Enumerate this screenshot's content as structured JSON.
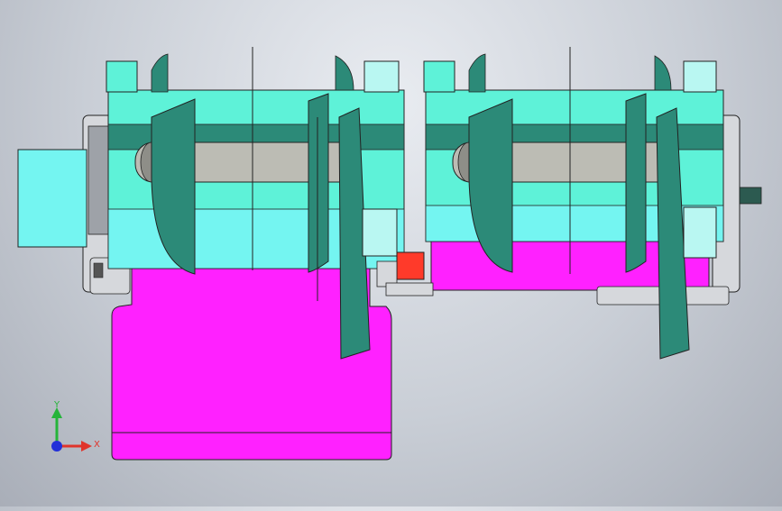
{
  "viewport": {
    "background_top": "#e9ecf1",
    "background_bottom": "#a9aeb8"
  },
  "colors": {
    "cyan_part": "#5ef2d8",
    "light_cyan_part": "#74f5f1",
    "pale_cyan_part": "#b9f7f2",
    "dark_teal_part": "#2c8a78",
    "roller": "#bcbcb4",
    "magenta_part": "#ff21ff",
    "red_part": "#ff3a2a",
    "metal_part": "#d6d8dc",
    "edge": "#222222"
  },
  "triad": {
    "y_label": "Y",
    "x_label": "X",
    "y_color": "#25b43a",
    "x_color": "#e0342b",
    "z_color": "#2230d8"
  }
}
